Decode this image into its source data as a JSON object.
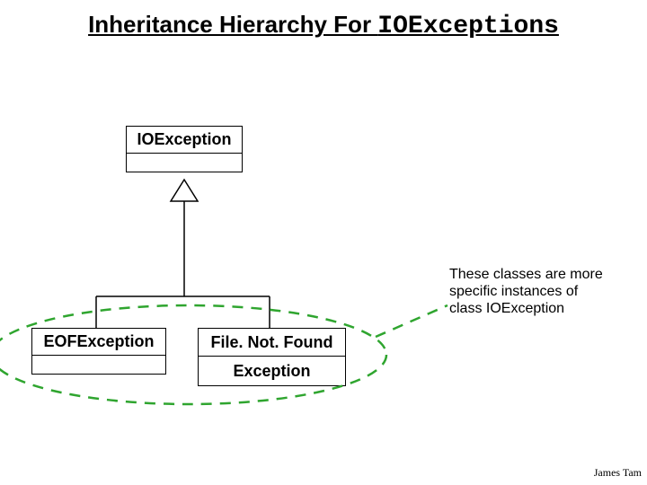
{
  "title": {
    "part1": "Inheritance Hierarchy For ",
    "part2_mono": "IOExceptions"
  },
  "classes": {
    "parent": "IOException",
    "child_left": "EOFException",
    "child_right_line1": "File. Not. Found",
    "child_right_line2": "Exception"
  },
  "note": {
    "line1": "These classes are more",
    "line2": "specific instances of",
    "line3": "class IOException"
  },
  "author": "James Tam",
  "colors": {
    "dashed_green": "#2fa52f"
  }
}
